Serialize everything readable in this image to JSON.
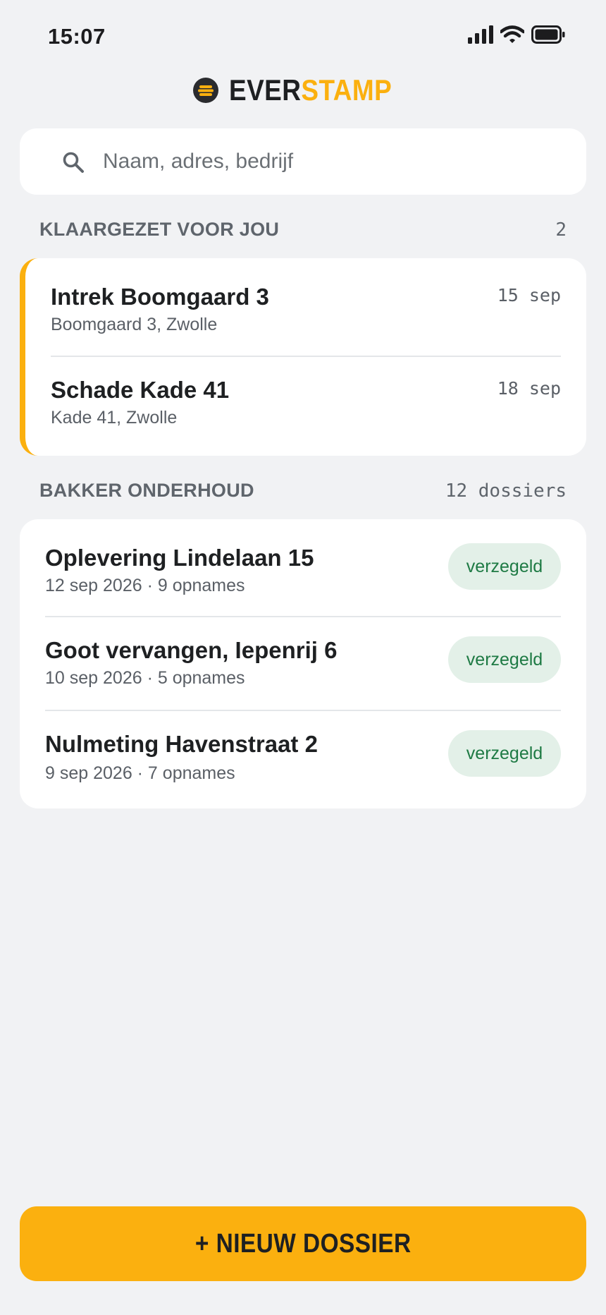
{
  "status_bar": {
    "time": "15:07"
  },
  "brand": {
    "part1": "EVER",
    "part2": "STAMP",
    "accent_color": "#fbb00f"
  },
  "search": {
    "placeholder": "Naam, adres, bedrijf",
    "value": ""
  },
  "prepared": {
    "title": "KLAARGEZET VOOR JOU",
    "count": "2",
    "items": [
      {
        "title": "Intrek Boomgaard 3",
        "address": "Boomgaard 3, Zwolle",
        "date": "15 sep"
      },
      {
        "title": "Schade Kade 41",
        "address": "Kade 41, Zwolle",
        "date": "18 sep"
      }
    ]
  },
  "company": {
    "title": "BAKKER ONDERHOUD",
    "count": "12 dossiers",
    "items": [
      {
        "title": "Oplevering Lindelaan 15",
        "meta": "12 sep 2026 · 9 opnames",
        "status": "verzegeld"
      },
      {
        "title": "Goot vervangen, Iepenrij 6",
        "meta": "10 sep 2026 · 5 opnames",
        "status": "verzegeld"
      },
      {
        "title": "Nulmeting Havenstraat 2",
        "meta": "9 sep 2026 · 7 opnames",
        "status": "verzegeld"
      }
    ]
  },
  "actions": {
    "new_dossier": "+ NIEUW DOSSIER"
  },
  "icons": {
    "cellular": "cellular-signal-icon",
    "wifi": "wifi-icon",
    "battery": "battery-icon",
    "logo": "everstamp-logo-icon",
    "search": "search-icon"
  }
}
